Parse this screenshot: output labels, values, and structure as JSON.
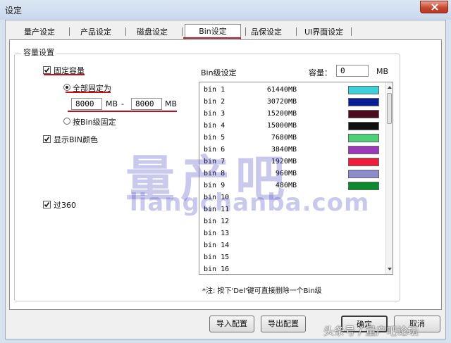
{
  "window": {
    "title": "设定"
  },
  "tabs": [
    {
      "label": "量产设定"
    },
    {
      "label": "产品设定"
    },
    {
      "label": "磁盘设定"
    },
    {
      "label": "Bin设定"
    },
    {
      "label": "品保设定"
    },
    {
      "label": "UI界面设定"
    }
  ],
  "active_tab": "Bin设定",
  "capacity": {
    "group_title": "容量设置",
    "fixed_capacity": {
      "label": "固定容量",
      "checked": true
    },
    "all_fixed": {
      "label": "全部固定为",
      "selected": true
    },
    "min_value": "8000",
    "min_unit": "MB",
    "dash": "-",
    "max_value": "8000",
    "max_unit": "MB",
    "by_bin": {
      "label": "按Bin级固定",
      "selected": false
    },
    "show_bin_color": {
      "label": "显示BIN颜色",
      "checked": true
    },
    "over360": {
      "label": "过360",
      "checked": true
    }
  },
  "bin_settings": {
    "title": "Bin级设定",
    "capacity_label": "容量：",
    "capacity_value": "0",
    "capacity_unit": "MB",
    "rows": [
      {
        "name": "bin 1",
        "size": "61440MB",
        "color": "#3ad0dc"
      },
      {
        "name": "bin 2",
        "size": "30720MB",
        "color": "#0a1e96"
      },
      {
        "name": "bin 3",
        "size": "15200MB",
        "color": "#4e0a1e"
      },
      {
        "name": "bin 4",
        "size": "15000MB",
        "color": "#101010"
      },
      {
        "name": "bin 5",
        "size": "7680MB",
        "color": "#4cd078"
      },
      {
        "name": "bin 6",
        "size": "3840MB",
        "color": "#9a3ab8"
      },
      {
        "name": "bin 7",
        "size": "1920MB",
        "color": "#f01e3c"
      },
      {
        "name": "bin 8",
        "size": "960MB",
        "color": "#8c8ccc"
      },
      {
        "name": "bin 9",
        "size": "480MB",
        "color": "#0a8a2a"
      },
      {
        "name": "bin 10",
        "size": "",
        "color": ""
      },
      {
        "name": "bin 11",
        "size": "",
        "color": ""
      },
      {
        "name": "bin 12",
        "size": "",
        "color": ""
      },
      {
        "name": "bin 13",
        "size": "",
        "color": ""
      },
      {
        "name": "bin 14",
        "size": "",
        "color": ""
      },
      {
        "name": "bin 15",
        "size": "",
        "color": ""
      },
      {
        "name": "bin 16",
        "size": "",
        "color": ""
      }
    ],
    "note": "*注: 按下'Del'键可直接删除一个Bin级"
  },
  "buttons": {
    "import": "导入配置",
    "export": "导出配置",
    "ok": "确定",
    "cancel": "取消"
  },
  "watermark": {
    "text": "量产吧",
    "url": "liangchanba.com"
  },
  "source_tag": "头条号 / 量产吧论坛",
  "colors": {
    "accent_red": "#c0101c",
    "close_red": "#c74a32"
  }
}
